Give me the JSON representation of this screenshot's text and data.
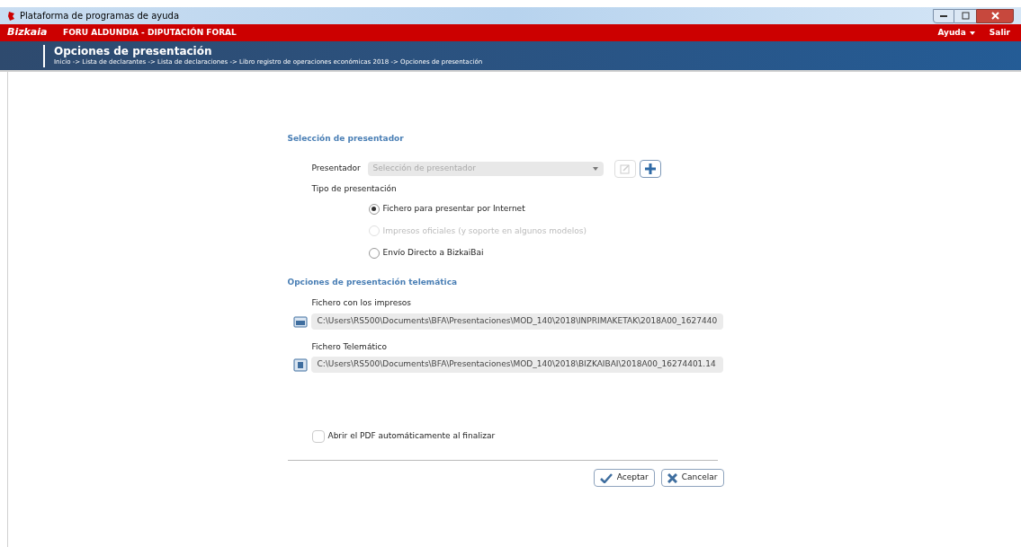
{
  "window": {
    "title": "Plataforma de programas de ayuda"
  },
  "topbar": {
    "logo": "Bizkaia",
    "org": "FORU ALDUNDIA - DIPUTACIÓN FORAL",
    "menu": [
      {
        "label": "Ayuda",
        "dropdown": true
      },
      {
        "label": "Salir",
        "dropdown": false
      }
    ]
  },
  "header": {
    "title": "Opciones de presentación",
    "breadcrumb": "Inicio -> Lista de declarantes -> Lista de declaraciones -> Libro registro de operaciones económicas 2018 -> Opciones de presentación"
  },
  "section1": {
    "title": "Selección de presentador",
    "presentador_label": "Presentador",
    "presentador_placeholder": "Selección de presentador",
    "edit_disabled": true,
    "tipo_label": "Tipo de presentación",
    "options": [
      {
        "label": "Fichero para presentar por Internet",
        "selected": true,
        "disabled": false
      },
      {
        "label": "Impresos oficiales (y soporte en algunos modelos)",
        "selected": false,
        "disabled": true
      },
      {
        "label": "Envío Directo a BizkaiBai",
        "selected": false,
        "disabled": false
      }
    ]
  },
  "section2": {
    "title": "Opciones de presentación telemática",
    "files": [
      {
        "label": "Fichero con los impresos",
        "kind": "pdf",
        "value": "C:\\Users\\RS500\\Documents\\BFA\\Presentaciones\\MOD_140\\2018\\INPRIMAKETAK\\2018A00_1627440"
      },
      {
        "label": "Fichero Telemático",
        "kind": "file",
        "value": "C:\\Users\\RS500\\Documents\\BFA\\Presentaciones\\MOD_140\\2018\\BIZKAIBAI\\2018A00_16274401.14"
      }
    ]
  },
  "auto_open": {
    "label": "Abrir el PDF automáticamente al finalizar",
    "checked": false
  },
  "buttons": [
    {
      "label": "Aceptar",
      "kind": "accept"
    },
    {
      "label": "Cancelar",
      "kind": "cancel"
    }
  ]
}
